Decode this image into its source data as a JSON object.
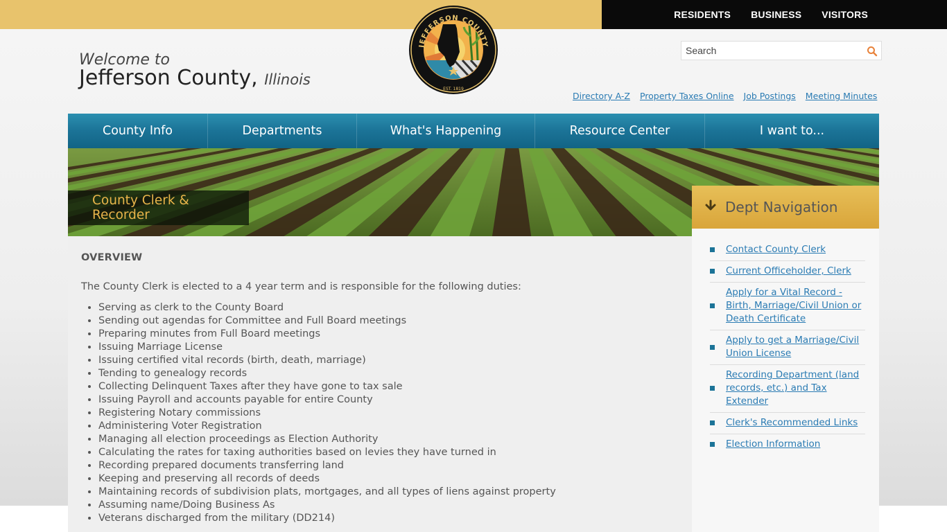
{
  "top_nav": [
    "RESIDENTS",
    "BUSINESS",
    "VISITORS"
  ],
  "welcome": {
    "line1": "Welcome to",
    "county": "Jefferson County,",
    "state": "Illinois"
  },
  "logo": {
    "text": "JEFFERSON COUNTY",
    "est": "EST. 1819"
  },
  "search": {
    "placeholder": "Search",
    "icon": "search-icon"
  },
  "quick_links": [
    "Directory A-Z",
    "Property Taxes Online",
    "Job Postings",
    "Meeting Minutes"
  ],
  "main_nav": [
    "County Info",
    "Departments",
    "What's Happening",
    "Resource Center",
    "I want to..."
  ],
  "page_title": "County Clerk & Recorder",
  "content": {
    "heading": "OVERVIEW",
    "intro": "The County Clerk is elected to a 4 year term and is responsible for the following duties:",
    "duties": [
      "Serving as clerk to the County Board",
      "Sending out agendas for Committee and Full Board meetings",
      "Preparing minutes from Full Board meetings",
      "Issuing Marriage License",
      "Issuing certified vital records (birth, death, marriage)",
      "Tending to genealogy records",
      "Collecting Delinquent Taxes after they have gone to tax sale",
      "Issuing Payroll and accounts payable for entire County",
      "Registering Notary commissions",
      "Administering Voter Registration",
      "Managing all election proceedings as Election Authority",
      "Calculating the rates for taxing authorities based on levies they have turned in",
      "Recording prepared documents transferring land",
      "Keeping and preserving all records of deeds",
      "Maintaining records of subdivision plats, mortgages, and all types of liens against property",
      "Assuming name/Doing Business As",
      "Veterans discharged from the military (DD214)"
    ]
  },
  "sidebar": {
    "title": "Dept Navigation",
    "icon": "arrow-down-icon",
    "links": [
      "Contact County Clerk",
      "Current Officeholder, Clerk",
      "Apply for a Vital Record - Birth, Marriage/Civil Union or Death Certificate",
      "Apply to get a Marriage/Civil Union License",
      "Recording Department (land records, etc.) and Tax Extender",
      "Clerk's Recommended Links",
      "Election Information"
    ]
  },
  "colors": {
    "gold": "#e8c36c",
    "nav_teal": "#1b7397",
    "link_blue": "#2a7bb3",
    "title_gold": "#e8b44a"
  }
}
